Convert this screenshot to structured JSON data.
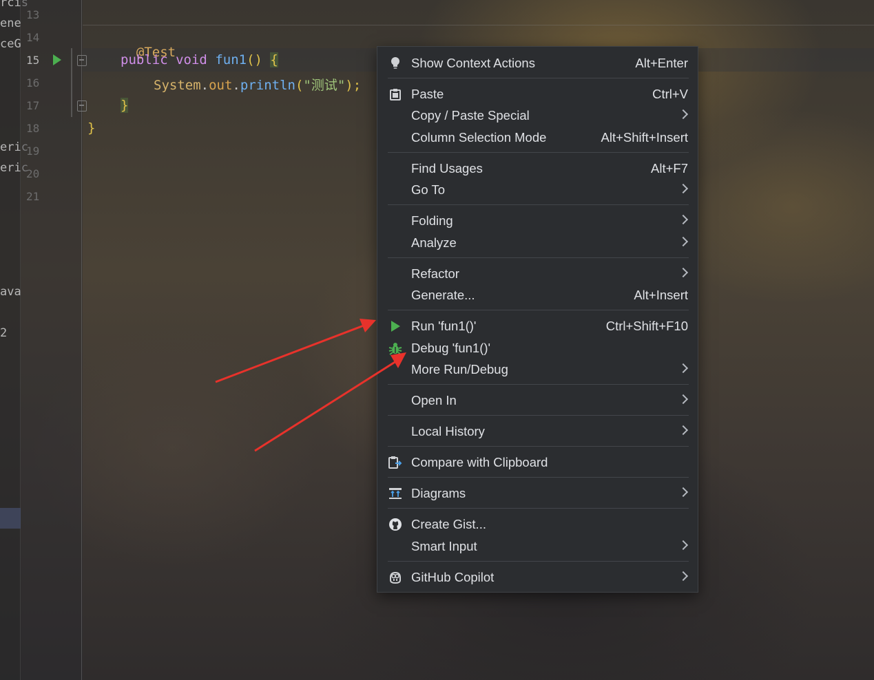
{
  "left_panel": {
    "fragments": [
      "rcis",
      "ene",
      "ceG",
      "eric",
      "eric",
      "ava",
      "2"
    ]
  },
  "gutter": {
    "line_numbers": [
      "13",
      "14",
      "15",
      "16",
      "17",
      "18",
      "19",
      "20",
      "21"
    ],
    "current_line": "15"
  },
  "editor": {
    "line14": {
      "annotation": "@Test"
    },
    "line15": {
      "kw1": "public",
      "kw2": "void",
      "fn": "fun1",
      "parens": "()",
      "brace": "{"
    },
    "line16": {
      "cls": "System",
      "dot1": ".",
      "field": "out",
      "dot2": ".",
      "method": "println",
      "open": "(",
      "str": "\"测试\"",
      "close": ");"
    },
    "line17": {
      "brace": "}"
    },
    "line18": {
      "brace": "}"
    }
  },
  "context_menu": {
    "items": [
      {
        "icon": "lightbulb-icon",
        "label": "Show Context Actions",
        "shortcut": "Alt+Enter",
        "submenu": false
      },
      {
        "icon": "clipboard-icon",
        "label": "Paste",
        "shortcut": "Ctrl+V",
        "submenu": false
      },
      {
        "icon": "",
        "label": "Copy / Paste Special",
        "shortcut": "",
        "submenu": true
      },
      {
        "icon": "",
        "label": "Column Selection Mode",
        "shortcut": "Alt+Shift+Insert",
        "submenu": false
      },
      {
        "icon": "",
        "label": "Find Usages",
        "shortcut": "Alt+F7",
        "submenu": false
      },
      {
        "icon": "",
        "label": "Go To",
        "shortcut": "",
        "submenu": true
      },
      {
        "icon": "",
        "label": "Folding",
        "shortcut": "",
        "submenu": true
      },
      {
        "icon": "",
        "label": "Analyze",
        "shortcut": "",
        "submenu": true
      },
      {
        "icon": "",
        "label": "Refactor",
        "shortcut": "",
        "submenu": true
      },
      {
        "icon": "",
        "label": "Generate...",
        "shortcut": "Alt+Insert",
        "submenu": false
      },
      {
        "icon": "run-icon",
        "label": "Run 'fun1()'",
        "shortcut": "Ctrl+Shift+F10",
        "submenu": false
      },
      {
        "icon": "debug-bug-icon",
        "label": "Debug 'fun1()'",
        "shortcut": "",
        "submenu": false
      },
      {
        "icon": "",
        "label": "More Run/Debug",
        "shortcut": "",
        "submenu": true
      },
      {
        "icon": "",
        "label": "Open In",
        "shortcut": "",
        "submenu": true
      },
      {
        "icon": "",
        "label": "Local History",
        "shortcut": "",
        "submenu": true
      },
      {
        "icon": "compare-clipboard-icon",
        "label": "Compare with Clipboard",
        "shortcut": "",
        "submenu": false
      },
      {
        "icon": "diagrams-icon",
        "label": "Diagrams",
        "shortcut": "",
        "submenu": true
      },
      {
        "icon": "github-icon",
        "label": "Create Gist...",
        "shortcut": "",
        "submenu": false
      },
      {
        "icon": "",
        "label": "Smart Input",
        "shortcut": "",
        "submenu": true
      },
      {
        "icon": "copilot-icon",
        "label": "GitHub Copilot",
        "shortcut": "",
        "submenu": true
      }
    ]
  },
  "colors": {
    "menu_bg": "#2b2d30",
    "menu_text": "#dfe1e5",
    "run_green": "#4caf50",
    "arrow_red": "#e8322b"
  }
}
